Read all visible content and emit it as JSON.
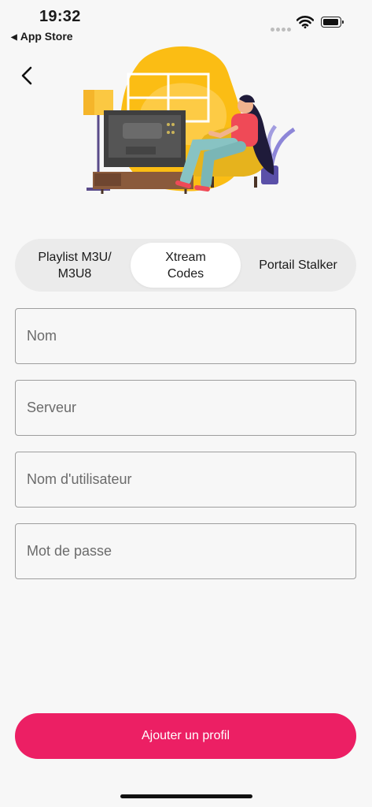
{
  "status_bar": {
    "time": "19:32",
    "back_app_label": "App Store",
    "icons": [
      "signal-dots-icon",
      "wifi-icon",
      "battery-icon"
    ]
  },
  "nav": {
    "back_icon": "chevron-left-icon"
  },
  "illustration": {
    "name": "woman-watching-tv-illustration"
  },
  "segmented_control": {
    "options": [
      {
        "label": "Playlist M3U/\nM3U8"
      },
      {
        "label": "Xtream\nCodes"
      },
      {
        "label": "Portail Stalker"
      }
    ],
    "selected_index": 1
  },
  "form": {
    "name": {
      "placeholder": "Nom",
      "value": ""
    },
    "server": {
      "placeholder": "Serveur",
      "value": ""
    },
    "username": {
      "placeholder": "Nom d'utilisateur",
      "value": ""
    },
    "password": {
      "placeholder": "Mot de passe",
      "value": ""
    }
  },
  "submit_label": "Ajouter un profil",
  "colors": {
    "accent": "#ec1f64",
    "background": "#f7f7f7",
    "segment_bg": "#ebebeb",
    "field_border": "#9e9e9e",
    "illustration_yellow": "#fbbd14"
  }
}
